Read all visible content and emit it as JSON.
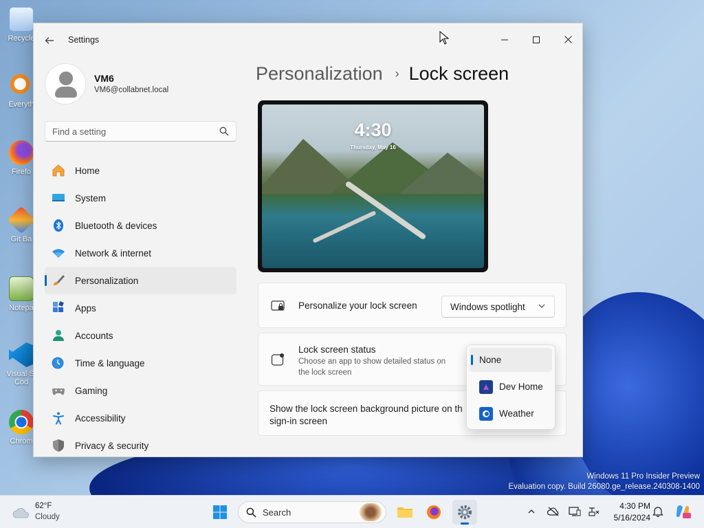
{
  "desktop": {
    "icons": [
      {
        "label": "Recycle"
      },
      {
        "label": "Everyth"
      },
      {
        "label": "Firefo"
      },
      {
        "label": "Git Ba"
      },
      {
        "label": "Notepa"
      },
      {
        "label": "Visual St Cod"
      },
      {
        "label": "Chrom"
      }
    ],
    "watermark_line1": "Windows 11 Pro Insider Preview",
    "watermark_line2": "Evaluation copy. Build 26080.ge_release.240308-1400"
  },
  "window": {
    "title": "Settings",
    "back_icon": "arrow-left-icon",
    "controls": {
      "minimize": "—",
      "maximize": "☐",
      "close": "✕"
    }
  },
  "profile": {
    "name": "VM6",
    "email": "VM6@collabnet.local"
  },
  "search": {
    "placeholder": "Find a setting",
    "value": ""
  },
  "nav": {
    "items": [
      {
        "label": "Home",
        "icon": "home-icon"
      },
      {
        "label": "System",
        "icon": "system-icon"
      },
      {
        "label": "Bluetooth & devices",
        "icon": "bluetooth-icon"
      },
      {
        "label": "Network & internet",
        "icon": "wifi-icon"
      },
      {
        "label": "Personalization",
        "icon": "brush-icon",
        "selected": true
      },
      {
        "label": "Apps",
        "icon": "apps-icon"
      },
      {
        "label": "Accounts",
        "icon": "person-icon"
      },
      {
        "label": "Time & language",
        "icon": "globe-clock-icon"
      },
      {
        "label": "Gaming",
        "icon": "controller-icon"
      },
      {
        "label": "Accessibility",
        "icon": "accessibility-icon"
      },
      {
        "label": "Privacy & security",
        "icon": "shield-icon"
      }
    ]
  },
  "content": {
    "breadcrumb_parent": "Personalization",
    "breadcrumb_separator": "›",
    "breadcrumb_current": "Lock screen",
    "preview": {
      "time": "4:30",
      "date": "Thursday, May 16"
    },
    "personalize": {
      "title": "Personalize your lock screen",
      "selected": "Windows spotlight"
    },
    "status": {
      "title": "Lock screen status",
      "description": "Choose an app to show detailed status on the lock screen"
    },
    "signin": {
      "title": "Show the lock screen background picture on th",
      "title_line2": "sign-in screen"
    },
    "status_menu": {
      "options": [
        {
          "label": "None",
          "selected": true
        },
        {
          "label": "Dev Home",
          "icon": "dev-home-icon"
        },
        {
          "label": "Weather",
          "icon": "weather-app-icon"
        }
      ]
    }
  },
  "taskbar": {
    "weather_temp": "62°F",
    "weather_condition": "Cloudy",
    "search_label": "Search",
    "clock_time": "4:30 PM",
    "clock_date": "5/16/2024"
  },
  "colors": {
    "accent": "#0067c0",
    "window_bg": "#f3f3f3",
    "card_bg": "#fbfbfb"
  }
}
